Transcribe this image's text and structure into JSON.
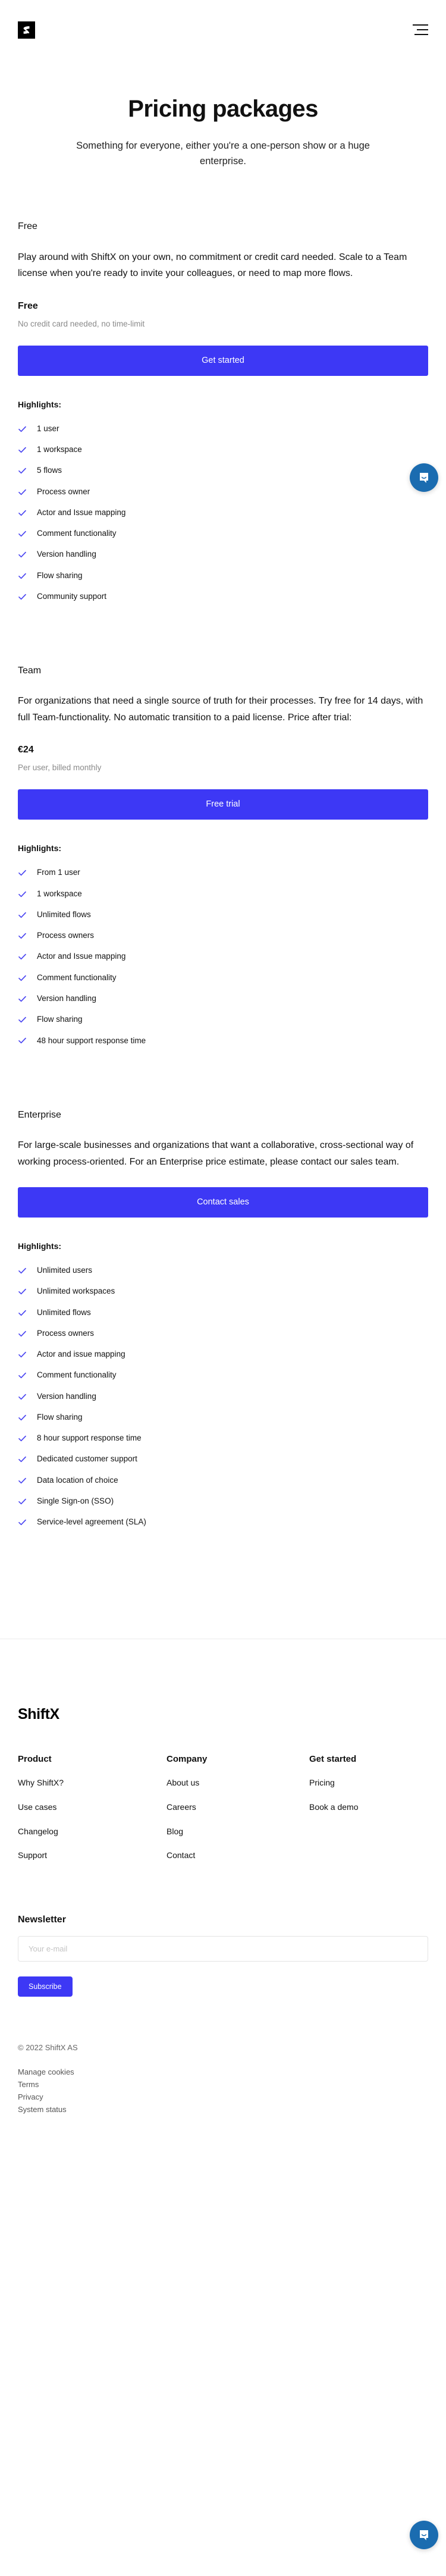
{
  "header": {
    "logo_alt": "ShiftX",
    "menu_label": "Menu"
  },
  "hero": {
    "title": "Pricing packages",
    "subtitle": "Something for everyone, either you're a one-person show or a huge enterprise."
  },
  "highlights_label": "Highlights:",
  "plans": [
    {
      "name": "Free",
      "description": "Play around with ShiftX on your own, no commitment or credit card needed. Scale to a Team license when you're ready to invite your colleagues, or need to map more flows.",
      "price": "Free",
      "price_note": "No credit card needed, no time-limit",
      "cta": "Get started",
      "features": [
        "1 user",
        "1 workspace",
        "5 flows",
        "Process owner",
        "Actor and Issue mapping",
        "Comment functionality",
        "Version handling",
        "Flow sharing",
        "Community support"
      ]
    },
    {
      "name": "Team",
      "description": "For organizations that need a single source of truth for their processes. Try free for 14 days, with full Team-functionality. No automatic transition to a paid license. Price after trial:",
      "price": "€24",
      "price_note": "Per user, billed monthly",
      "cta": "Free trial",
      "features": [
        "From 1 user",
        "1 workspace",
        "Unlimited flows",
        "Process owners",
        "Actor and Issue mapping",
        "Comment functionality",
        "Version handling",
        "Flow sharing",
        "48 hour support response time"
      ]
    },
    {
      "name": "Enterprise",
      "description": "For large-scale businesses and organizations that want a collaborative, cross-sectional way of working process-oriented. For an Enterprise price estimate, please contact our sales team.",
      "price": "",
      "price_note": "",
      "cta": "Contact sales",
      "features": [
        "Unlimited users",
        "Unlimited workspaces",
        "Unlimited flows",
        "Process owners",
        "Actor and issue mapping",
        "Comment functionality",
        "Version handling",
        "Flow sharing",
        "8 hour support response time",
        "Dedicated customer support",
        "Data location of choice",
        "Single Sign-on (SSO)",
        "Service-level agreement (SLA)"
      ]
    }
  ],
  "footer": {
    "logo": "ShiftX",
    "columns": [
      {
        "title": "Product",
        "links": [
          "Why ShiftX?",
          "Use cases",
          "Changelog",
          "Support"
        ]
      },
      {
        "title": "Company",
        "links": [
          "About us",
          "Careers",
          "Blog",
          "Contact"
        ]
      },
      {
        "title": "Get started",
        "links": [
          "Pricing",
          "Book a demo"
        ]
      }
    ],
    "newsletter": {
      "title": "Newsletter",
      "placeholder": "Your e-mail",
      "value": "",
      "submit": "Subscribe"
    },
    "copyright": "© 2022 ShiftX AS",
    "legal_links": [
      "Manage cookies",
      "Terms",
      "Privacy",
      "System status"
    ]
  },
  "icons": {
    "check": "check-icon",
    "chat": "chat-icon",
    "hamburger": "hamburger-menu-icon"
  },
  "colors": {
    "accent": "#3d38f5",
    "check": "#4b46f2",
    "chat": "#1b6cb0",
    "muted": "#8a8a8a"
  }
}
